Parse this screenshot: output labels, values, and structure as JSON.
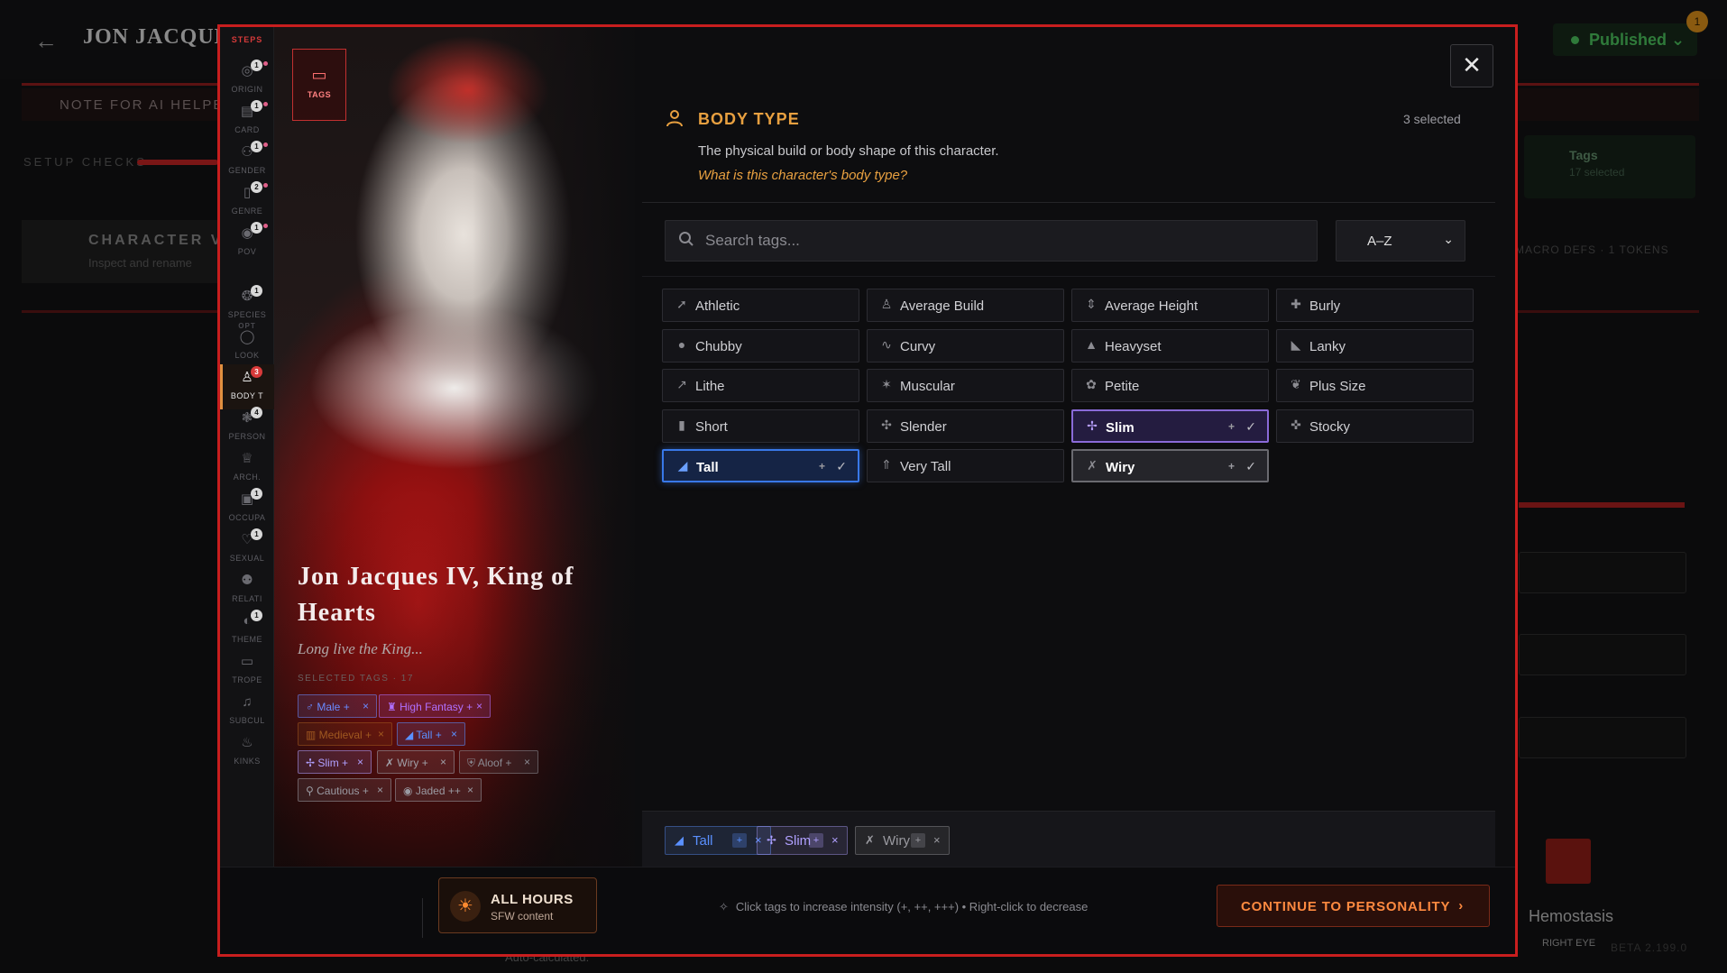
{
  "background": {
    "title": "JON JACQUES",
    "status": "Published",
    "notifications": "1",
    "note": "NOTE FOR AI HELPER",
    "setup_checks": "SETUP CHECKS",
    "character_title": "CHARACTER VA",
    "character_sub": "Inspect and rename",
    "tags_label": "Tags",
    "tags_sub": "17 selected",
    "macro": "MACRO DEFS · 1 TOKENS",
    "hemostasis": "Hemostasis",
    "right_eye": "RIGHT EYE",
    "beta": "BETA 2.199.0",
    "bottom": "Auto-calculated:"
  },
  "steps": {
    "title": "STEPS",
    "opt_label": "OPT",
    "items": [
      {
        "label": "ORIGIN",
        "badge": "1",
        "icon": "compass-icon"
      },
      {
        "label": "CARD",
        "badge": "1",
        "icon": "card-icon"
      },
      {
        "label": "GENDER",
        "badge": "1",
        "icon": "users-icon"
      },
      {
        "label": "GENRE",
        "badge": "2",
        "icon": "book-icon"
      },
      {
        "label": "POV",
        "badge": "1",
        "icon": "eye-icon"
      },
      {
        "label": "SPECIES",
        "badge": "1",
        "icon": "paw-icon"
      },
      {
        "label": "LOOK",
        "badge": "",
        "icon": "mirror-icon"
      },
      {
        "label": "BODY T",
        "badge": "3",
        "icon": "person-icon"
      },
      {
        "label": "PERSON",
        "badge": "4",
        "icon": "brain-icon"
      },
      {
        "label": "ARCH.",
        "badge": "",
        "icon": "crown-icon"
      },
      {
        "label": "OCCUPA",
        "badge": "1",
        "icon": "briefcase-icon"
      },
      {
        "label": "SEXUAL",
        "badge": "1",
        "icon": "heart-icon"
      },
      {
        "label": "RELATI",
        "badge": "",
        "icon": "people-icon"
      },
      {
        "label": "THEME",
        "badge": "1",
        "icon": "palette-icon"
      },
      {
        "label": "TROPE",
        "badge": "",
        "icon": "bookmark-icon"
      },
      {
        "label": "SUBCUL",
        "badge": "",
        "icon": "music-icon"
      },
      {
        "label": "KINKS",
        "badge": "",
        "icon": "flame-icon"
      }
    ]
  },
  "portrait": {
    "tags_button": "TAGS",
    "name": "Jon Jacques IV, King of Hearts",
    "tagline": "Long live the King...",
    "selected_tags_title": "SELECTED TAGS · 17",
    "tags": [
      {
        "label": "Male",
        "intensity": "+",
        "icon": "male-icon",
        "color": "#6a8aff"
      },
      {
        "label": "High Fantasy",
        "intensity": "+",
        "icon": "castle-icon",
        "color": "#b070ff"
      },
      {
        "label": "Medieval",
        "intensity": "+",
        "icon": "tower-icon",
        "color": "#a05820"
      },
      {
        "label": "Tall",
        "intensity": "+",
        "icon": "tall-icon",
        "color": "#5a90ff"
      },
      {
        "label": "Slim",
        "intensity": "+",
        "icon": "slim-icon",
        "color": "#b0a0ff"
      },
      {
        "label": "Wiry",
        "intensity": "+",
        "icon": "wiry-icon",
        "color": "#a0a0a8"
      },
      {
        "label": "Aloof",
        "intensity": "+",
        "icon": "shield-icon",
        "color": "#8a8a92"
      },
      {
        "label": "Cautious",
        "intensity": "+",
        "icon": "search-icon",
        "color": "#9a9aa2"
      },
      {
        "label": "Jaded",
        "intensity": "++",
        "icon": "eye-icon",
        "color": "#9a9aa2"
      }
    ]
  },
  "section": {
    "title": "BODY TYPE",
    "count": "3 selected",
    "description": "The physical build or body shape of this character.",
    "question": "What is this character's body type?",
    "search_placeholder": "Search tags...",
    "sort": "A–Z"
  },
  "tags": [
    {
      "label": "Athletic",
      "icon": "runner-icon",
      "state": "none"
    },
    {
      "label": "Average Build",
      "icon": "person-icon",
      "state": "none"
    },
    {
      "label": "Average Height",
      "icon": "height-icon",
      "state": "none"
    },
    {
      "label": "Burly",
      "icon": "burly-icon",
      "state": "none"
    },
    {
      "label": "Chubby",
      "icon": "chubby-icon",
      "state": "none"
    },
    {
      "label": "Curvy",
      "icon": "curvy-icon",
      "state": "none"
    },
    {
      "label": "Heavyset",
      "icon": "weight-icon",
      "state": "none"
    },
    {
      "label": "Lanky",
      "icon": "lanky-icon",
      "state": "none"
    },
    {
      "label": "Lithe",
      "icon": "lithe-icon",
      "state": "none"
    },
    {
      "label": "Muscular",
      "icon": "muscle-icon",
      "state": "none"
    },
    {
      "label": "Petite",
      "icon": "petite-icon",
      "state": "none"
    },
    {
      "label": "Plus Size",
      "icon": "plus-size-icon",
      "state": "none"
    },
    {
      "label": "Short",
      "icon": "short-icon",
      "state": "none"
    },
    {
      "label": "Slender",
      "icon": "slender-icon",
      "state": "none"
    },
    {
      "label": "Slim",
      "icon": "slim-icon",
      "state": "purple",
      "intensity": "+"
    },
    {
      "label": "Stocky",
      "icon": "stocky-icon",
      "state": "none"
    },
    {
      "label": "Tall",
      "icon": "tall-icon",
      "state": "blue",
      "intensity": "+"
    },
    {
      "label": "Very Tall",
      "icon": "very-tall-icon",
      "state": "none"
    },
    {
      "label": "Wiry",
      "icon": "wiry-icon",
      "state": "gray",
      "intensity": "+"
    }
  ],
  "selected_bar": [
    {
      "label": "Tall",
      "icon": "tall-icon",
      "intensity": "+",
      "color": "#5a90ff"
    },
    {
      "label": "Slim",
      "icon": "slim-icon",
      "intensity": "+",
      "color": "#b0a0ff"
    },
    {
      "label": "Wiry",
      "icon": "wiry-icon",
      "intensity": "+",
      "color": "#9a9aa0"
    }
  ],
  "footer": {
    "hours_title": "ALL HOURS",
    "hours_sub": "SFW content",
    "hint": "Click tags to increase intensity (+, ++, +++)  •  Right-click to decrease",
    "continue": "CONTINUE TO PERSONALITY"
  }
}
